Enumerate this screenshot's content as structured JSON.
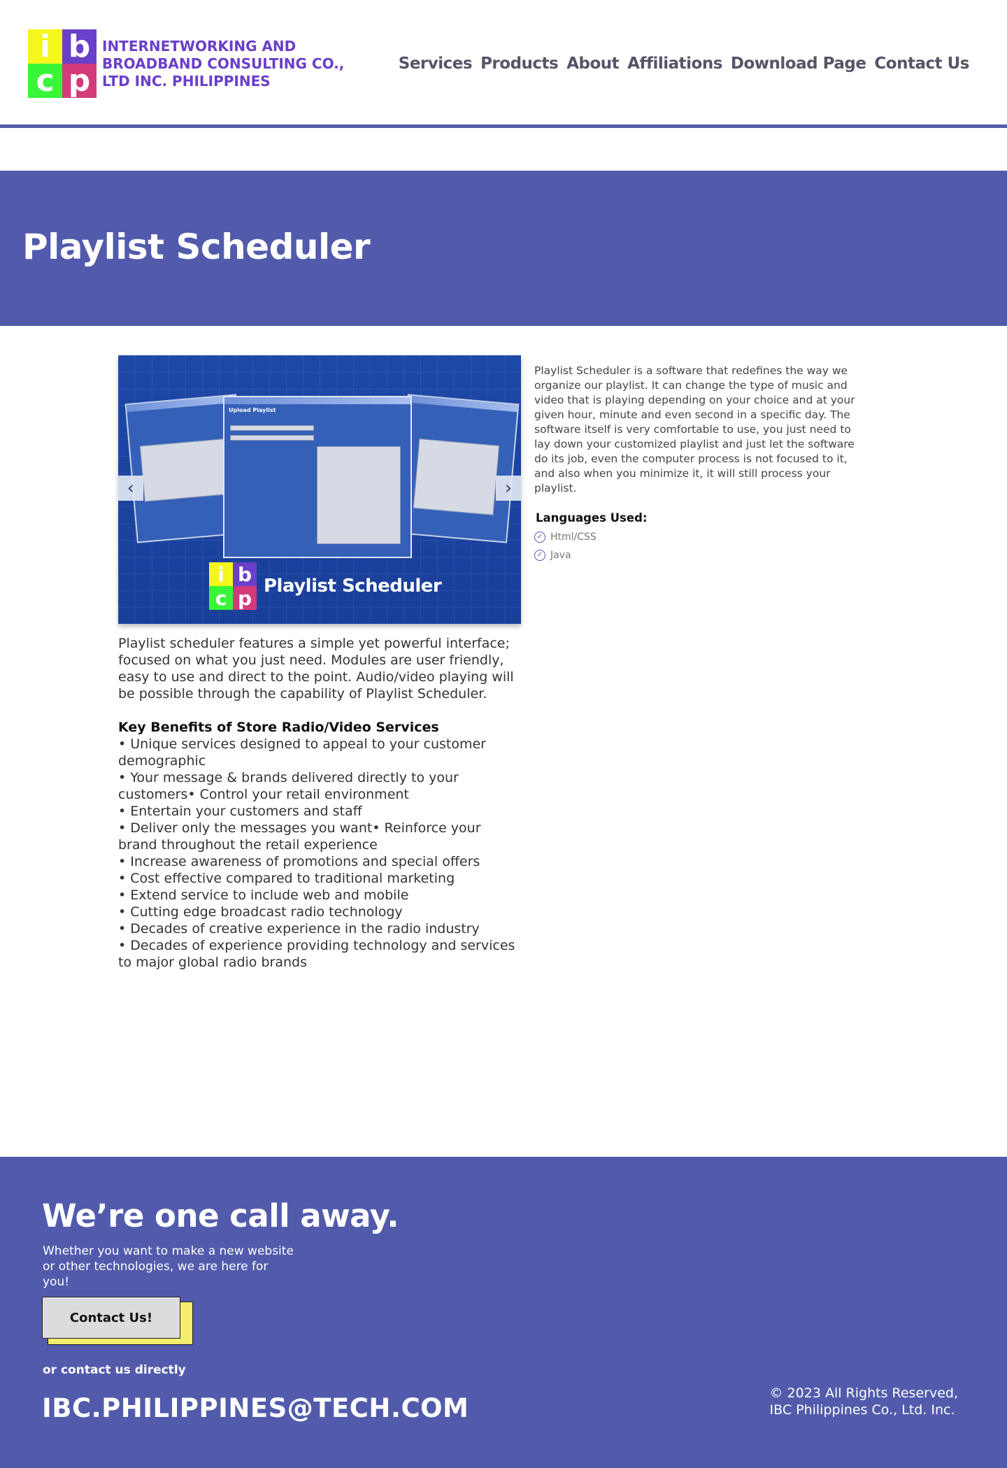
{
  "header": {
    "logo_letters": [
      "i",
      "b",
      "c",
      "p"
    ],
    "logo_text_lines": [
      "INTERNETWORKING AND",
      "BROADBAND CONSULTING CO.,",
      "LTD INC. PHILIPPINES"
    ],
    "nav": [
      "Services",
      "Products",
      "About",
      "Affiliations",
      "Download Page",
      "Contact Us"
    ]
  },
  "hero": {
    "title": "Playlist Scheduler"
  },
  "slider": {
    "caption": "Playlist Scheduler",
    "window_title": "Upload Playlist",
    "left_arrow": "‹",
    "right_arrow": "›"
  },
  "main": {
    "description": "Playlist scheduler features a simple yet powerful interface; focused on what you just need. Modules are user friendly, easy to use and direct to the point. Audio/video playing will be possible through the capability of Playlist Scheduler.",
    "key_benefits_title": "Key Benefits of Store Radio/Video Services",
    "key_benefits": [
      "• Unique services designed to appeal to your customer demographic",
      "• Your message & brands delivered directly to your customers• Control your retail environment",
      "• Entertain your customers and staff",
      "• Deliver only the messages you want• Reinforce your brand throughout the retail experience",
      "• Increase awareness of promotions and special offers",
      "• Cost effective compared to traditional marketing",
      "• Extend service to include web and mobile",
      "• Cutting edge broadcast radio technology",
      "• Decades of creative experience in the radio industry",
      "• Decades of experience providing technology and services to major global radio brands"
    ]
  },
  "sidebar": {
    "intro": "Playlist Scheduler is a software that redefines the way we organize our playlist. It can change the type of music and video that is playing depending on your choice and at your given hour, minute and even second in a specific day. The software itself is very comfortable to use, you just need to lay down your customized playlist and just let the software do its job, even the computer process is not focused to it, and also when you minimize it, it will still process your playlist.",
    "languages_title": "Languages Used:",
    "languages": [
      "Html/CSS",
      "Java"
    ]
  },
  "footer": {
    "heading": "We’re one call away.",
    "subtext": "Whether you want to make a new website or other technologies, we are here for you!",
    "cta_label": "Contact Us!",
    "or_contact": "or contact us directly",
    "email": "IBC.PHILIPPINES@TECH.COM",
    "copyright_line1": "© 2023 All Rights Reserved,",
    "copyright_line2": "IBC Philippines Co., Ltd. Inc."
  },
  "colors": {
    "brand_blue": "#525bab",
    "logo_yellow": "#f4f61c",
    "logo_purple": "#6a3fc9",
    "logo_green": "#38f53a",
    "logo_pink": "#d23a79",
    "cta_shadow_yellow": "#f3ec6c"
  }
}
